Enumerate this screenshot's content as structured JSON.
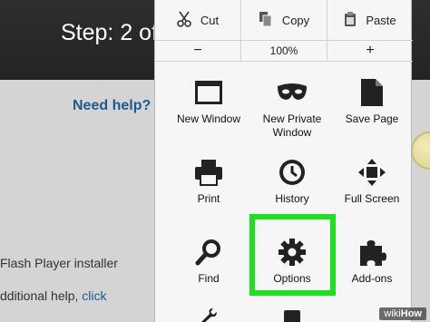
{
  "background": {
    "step_text": "Step: 2 of",
    "help_link": "Need help?",
    "installer_text": "Flash Player installer",
    "help_text_prefix": "dditional help, ",
    "help_text_link": "click"
  },
  "edit_row": {
    "cut": "Cut",
    "copy": "Copy",
    "paste": "Paste"
  },
  "zoom_row": {
    "zoom_out": "−",
    "level": "100%",
    "zoom_in": "+"
  },
  "tiles": [
    {
      "label": "New Window",
      "icon": "window-icon"
    },
    {
      "label": "New Private Window",
      "icon": "mask-icon"
    },
    {
      "label": "Save Page",
      "icon": "page-icon"
    },
    {
      "label": "Print",
      "icon": "printer-icon"
    },
    {
      "label": "History",
      "icon": "clock-icon"
    },
    {
      "label": "Full Screen",
      "icon": "fullscreen-icon"
    },
    {
      "label": "Find",
      "icon": "magnifier-icon"
    },
    {
      "label": "Options",
      "icon": "gear-icon"
    },
    {
      "label": "Add-ons",
      "icon": "puzzle-icon"
    }
  ],
  "highlight_color": "#1ee01e",
  "watermark": {
    "prefix": "wiki",
    "suffix": "How"
  }
}
